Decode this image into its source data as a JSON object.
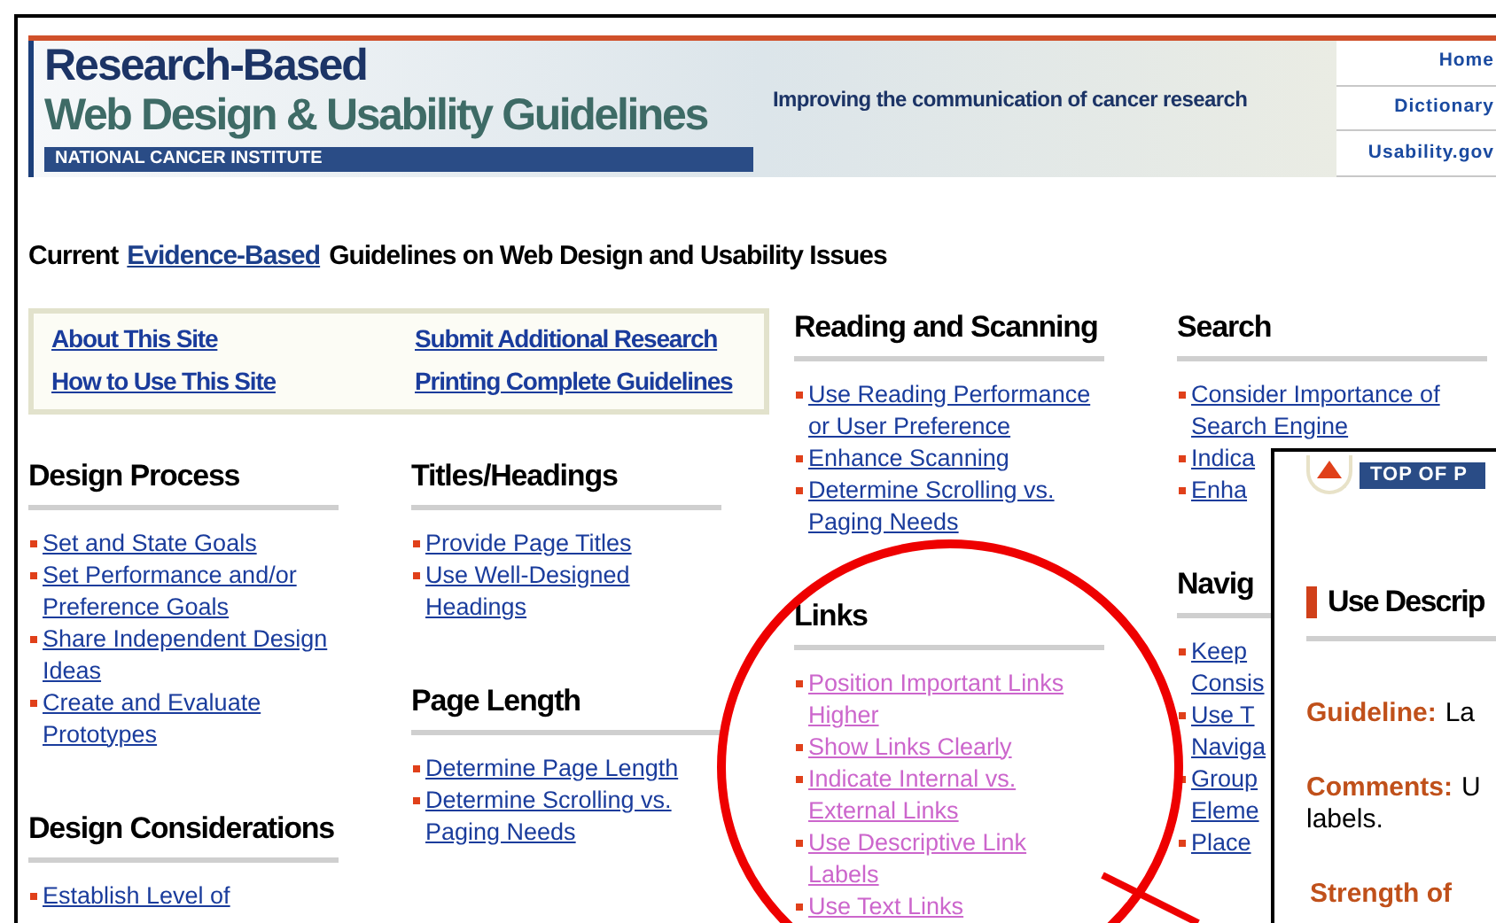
{
  "banner": {
    "title_line_1": "Research-Based",
    "title_line_2": "Web Design & Usability Guidelines",
    "institute": "NATIONAL CANCER INSTITUTE",
    "tagline": "Improving the communication of cancer research",
    "nav": [
      "Home",
      "Dictionary",
      "Usability.gov"
    ]
  },
  "intro": {
    "before": "Current",
    "link": "Evidence-Based",
    "after": "Guidelines on Web Design and Usability Issues"
  },
  "info_box": {
    "links": [
      "About This Site",
      "Submit Additional Research",
      "How to Use This Site",
      "Printing Complete Guidelines"
    ]
  },
  "columns": [
    {
      "sections": [
        {
          "heading": "Design Process",
          "items": [
            {
              "lines": [
                "Set and State Goals"
              ],
              "visited": false
            },
            {
              "lines": [
                "Set Performance and/or",
                "Preference Goals"
              ],
              "visited": false
            },
            {
              "lines": [
                "Share Independent Design",
                "Ideas"
              ],
              "visited": false
            },
            {
              "lines": [
                "Create and Evaluate",
                "Prototypes"
              ],
              "visited": false
            }
          ]
        },
        {
          "heading": "Design Considerations",
          "items": [
            {
              "lines": [
                "Establish Level of"
              ],
              "visited": false
            }
          ]
        }
      ]
    },
    {
      "sections": [
        {
          "heading": "Titles/Headings",
          "items": [
            {
              "lines": [
                "Provide Page Titles"
              ],
              "visited": false
            },
            {
              "lines": [
                "Use Well-Designed",
                "Headings"
              ],
              "visited": false
            }
          ]
        },
        {
          "heading": "Page Length",
          "items": [
            {
              "lines": [
                "Determine Page Length"
              ],
              "visited": false
            },
            {
              "lines": [
                "Determine Scrolling vs.",
                "Paging Needs"
              ],
              "visited": false
            }
          ]
        }
      ]
    },
    {
      "sections": [
        {
          "heading": "Reading and Scanning",
          "items": [
            {
              "lines": [
                "Use Reading Performance",
                "or User Preference"
              ],
              "visited": false
            },
            {
              "lines": [
                "Enhance Scanning"
              ],
              "visited": false
            },
            {
              "lines": [
                "Determine Scrolling vs.",
                "Paging Needs"
              ],
              "visited": false
            }
          ]
        },
        {
          "heading": "Links",
          "items": [
            {
              "lines": [
                "Position Important Links",
                "Higher"
              ],
              "visited": true
            },
            {
              "lines": [
                "Show Links Clearly"
              ],
              "visited": true
            },
            {
              "lines": [
                "Indicate Internal vs.",
                "External Links"
              ],
              "visited": true
            },
            {
              "lines": [
                "Use Descriptive Link",
                "Labels"
              ],
              "visited": true
            },
            {
              "lines": [
                "Use Text Links"
              ],
              "visited": true
            }
          ]
        }
      ]
    },
    {
      "sections": [
        {
          "heading": "Search",
          "items": [
            {
              "lines": [
                "Consider Importance of",
                "Search Engine"
              ],
              "visited": false
            },
            {
              "lines": [
                "Indica"
              ],
              "visited": false
            },
            {
              "lines": [
                "Enha"
              ],
              "visited": false
            }
          ]
        },
        {
          "heading": "Navig",
          "items": [
            {
              "lines": [
                "Keep",
                "Consis"
              ],
              "visited": false
            },
            {
              "lines": [
                "Use T",
                "Naviga"
              ],
              "visited": false
            },
            {
              "lines": [
                "Group",
                "Eleme"
              ],
              "visited": false
            },
            {
              "lines": [
                "Place"
              ],
              "visited": false
            }
          ]
        }
      ]
    }
  ],
  "popup": {
    "top_button": "TOP OF P",
    "heading": "Use Descrip",
    "guideline_label": "Guideline:",
    "guideline_text": "La",
    "comments_label": "Comments:",
    "comments_lines": [
      "U",
      "labels."
    ],
    "strength_label": "Strength of"
  }
}
